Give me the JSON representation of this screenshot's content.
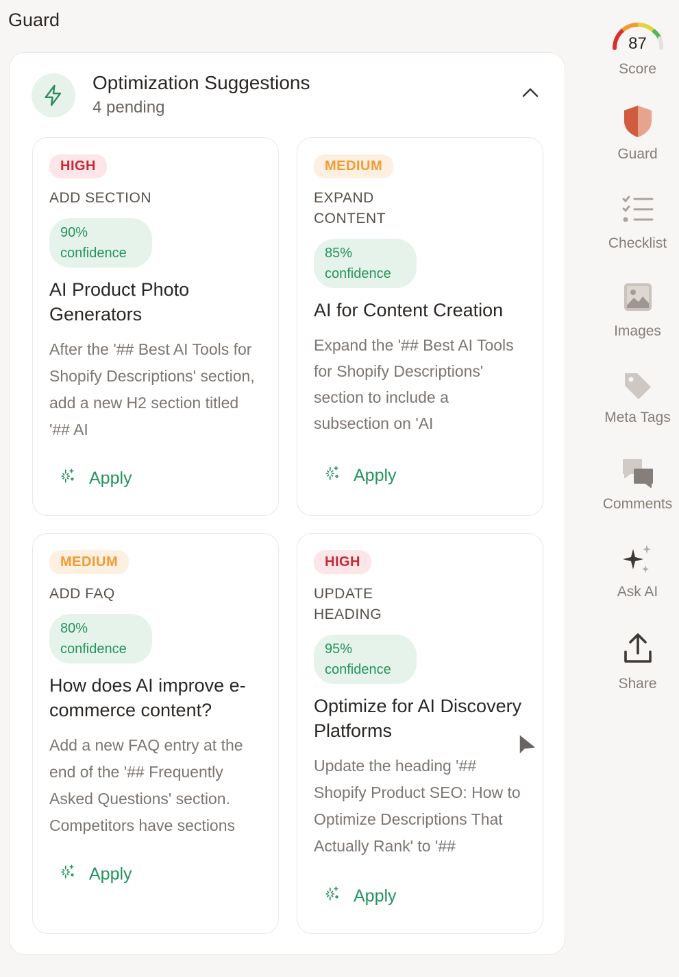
{
  "header": {
    "title": "Guard"
  },
  "panel": {
    "title": "Optimization Suggestions",
    "subtitle": "4 pending"
  },
  "cards": [
    {
      "priority": "HIGH",
      "category": "ADD SECTION",
      "confidence": "90% confidence",
      "title": "AI Product Photo Generators",
      "description": "After the '## Best AI Tools for Shopify Descriptions' section, add a new H2 section titled '## AI",
      "apply_label": "Apply"
    },
    {
      "priority": "MEDIUM",
      "category": "EXPAND CONTENT",
      "confidence": "85% confidence",
      "title": "AI for Content Creation",
      "description": "Expand the '## Best AI Tools for Shopify Descriptions' section to include a subsection on 'AI",
      "apply_label": "Apply"
    },
    {
      "priority": "MEDIUM",
      "category": "ADD FAQ",
      "confidence": "80% confidence",
      "title": "How does AI improve e-commerce content?",
      "description": "Add a new FAQ entry at the end of the '## Frequently Asked Questions' section. Competitors have sections",
      "apply_label": "Apply"
    },
    {
      "priority": "HIGH",
      "category": "UPDATE HEADING",
      "confidence": "95% confidence",
      "title": "Optimize for AI Discovery Platforms",
      "description": "Update the heading '## Shopify Product SEO: How to Optimize Descriptions That Actually Rank' to '##",
      "apply_label": "Apply"
    }
  ],
  "sidebar": {
    "score": {
      "value": "87",
      "label": "Score"
    },
    "items": [
      {
        "label": "Guard",
        "icon": "shield-icon"
      },
      {
        "label": "Checklist",
        "icon": "checklist-icon"
      },
      {
        "label": "Images",
        "icon": "image-icon"
      },
      {
        "label": "Meta Tags",
        "icon": "tag-icon"
      },
      {
        "label": "Comments",
        "icon": "comments-icon"
      },
      {
        "label": "Ask AI",
        "icon": "sparkle-icon"
      },
      {
        "label": "Share",
        "icon": "share-icon"
      }
    ]
  },
  "colors": {
    "accent_green": "#23945a",
    "high_badge": "#c62937",
    "medium_badge": "#f29a34",
    "guard_shield": "#d96c47"
  }
}
